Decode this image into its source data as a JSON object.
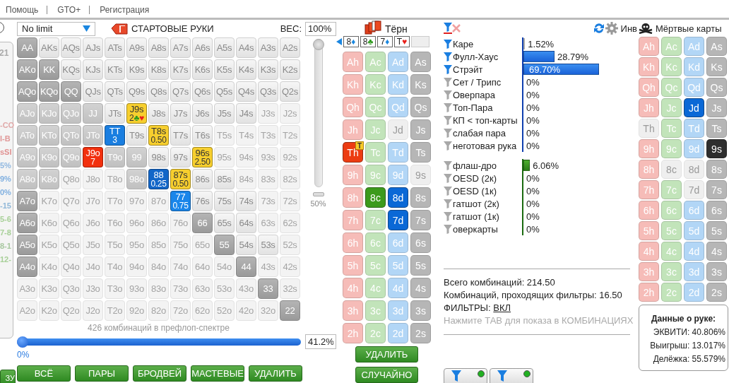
{
  "menu": [
    {
      "label": "Помощь"
    },
    {
      "label": "GTO+"
    },
    {
      "label": "Регистрация"
    }
  ],
  "side": {
    "count": "21",
    "fragments": [
      {
        "text": "-CO",
        "color": "#e0a8a8"
      },
      {
        "text": "I-B",
        "color": "#e09898"
      },
      {
        "text": "sSI",
        "color": "#e09090"
      },
      {
        "text": "5%",
        "color": "#90b8e0"
      },
      {
        "text": "9%",
        "color": "#80b0e0"
      },
      {
        "text": "0%",
        "color": "#80b0e0"
      },
      {
        "text": "-15",
        "color": "#90b8d8"
      },
      {
        "text": "5-6",
        "color": "#a8d098"
      },
      {
        "text": "7-8",
        "color": "#a8d098"
      },
      {
        "text": "8-1",
        "color": "#a8c8a0"
      },
      {
        "text": "12-",
        "color": "#a8d098"
      }
    ],
    "button": "ЗУ",
    "radio_selected": false
  },
  "range": {
    "game": "No limit",
    "title": "СТАРТОВЫЕ РУКИ",
    "weight_label": "ВЕС:",
    "weight": "100%",
    "weight_slider": {
      "level": 1,
      "mark": "50%"
    },
    "hands": [
      {
        "cells": [
          {
            "label": "AA",
            "kind": "full"
          },
          {
            "label": "AKs",
            "kind": "open"
          },
          {
            "label": "AQs",
            "kind": "open"
          },
          {
            "label": "AJs",
            "kind": "open"
          },
          {
            "label": "ATs",
            "kind": "open"
          },
          {
            "label": "A9s",
            "kind": "open"
          },
          {
            "label": "A8s",
            "kind": "open"
          },
          {
            "label": "A7s",
            "kind": "open"
          },
          {
            "label": "A6s",
            "kind": "open"
          },
          {
            "label": "A5s",
            "kind": "open"
          },
          {
            "label": "A4s",
            "kind": "open"
          },
          {
            "label": "A3s",
            "kind": "open"
          },
          {
            "label": "A2s",
            "kind": "open"
          }
        ]
      },
      {
        "cells": [
          {
            "label": "AKo",
            "kind": "full"
          },
          {
            "label": "KK",
            "kind": "full"
          },
          {
            "label": "KQs",
            "kind": "open"
          },
          {
            "label": "KJs",
            "kind": "open"
          },
          {
            "label": "KTs",
            "kind": "open"
          },
          {
            "label": "K9s",
            "kind": "open"
          },
          {
            "label": "K8s",
            "kind": "open"
          },
          {
            "label": "K7s",
            "kind": "open"
          },
          {
            "label": "K6s",
            "kind": "open"
          },
          {
            "label": "K5s",
            "kind": "open"
          },
          {
            "label": "K4s",
            "kind": "open"
          },
          {
            "label": "K3s",
            "kind": "open"
          },
          {
            "label": "K2s",
            "kind": "open"
          }
        ]
      },
      {
        "cells": [
          {
            "label": "AQo",
            "kind": "full"
          },
          {
            "label": "KQo",
            "kind": "full"
          },
          {
            "label": "QQ",
            "kind": "full"
          },
          {
            "label": "QJs",
            "kind": "open"
          },
          {
            "label": "QTs",
            "kind": "open"
          },
          {
            "label": "Q9s",
            "kind": "open"
          },
          {
            "label": "Q8s",
            "kind": "open"
          },
          {
            "label": "Q7s",
            "kind": "open"
          },
          {
            "label": "Q6s",
            "kind": "open"
          },
          {
            "label": "Q5s",
            "kind": "open"
          },
          {
            "label": "Q4s",
            "kind": "open"
          },
          {
            "label": "Q3s",
            "kind": "open"
          },
          {
            "label": "Q2s",
            "kind": "open"
          }
        ]
      },
      {
        "cells": [
          {
            "label": "AJo",
            "kind": "partial"
          },
          {
            "label": "KJo",
            "kind": "partial"
          },
          {
            "label": "QJo",
            "kind": "partial"
          },
          {
            "label": "JJ",
            "kind": "partial"
          },
          {
            "label": "JTs",
            "kind": "open"
          },
          {
            "label": "J9s",
            "kind": "marked",
            "color": "#f7cf2e",
            "note": "2",
            "suits": [
              {
                "symbol": "♣",
                "color": "#2e9a1e"
              },
              {
                "symbol": "♥",
                "color": "#e8201a"
              }
            ]
          },
          {
            "label": "J8s",
            "kind": "open"
          },
          {
            "label": "J7s",
            "kind": "open"
          },
          {
            "label": "J6s",
            "kind": "open"
          },
          {
            "label": "J5s",
            "kind": "open"
          },
          {
            "label": "J4s",
            "kind": "open"
          },
          {
            "label": "J3s",
            "kind": "faded"
          },
          {
            "label": "J2s",
            "kind": "faded"
          }
        ]
      },
      {
        "cells": [
          {
            "label": "ATo",
            "kind": "partial"
          },
          {
            "label": "KTo",
            "kind": "partial"
          },
          {
            "label": "QTo",
            "kind": "partial"
          },
          {
            "label": "JTo",
            "kind": "partial"
          },
          {
            "label": "TT",
            "kind": "marked",
            "color": "#1a7ee0",
            "note": "3"
          },
          {
            "label": "T9s",
            "kind": "open"
          },
          {
            "label": "T8s",
            "kind": "marked",
            "color": "#f7cf2e",
            "note": "0.50"
          },
          {
            "label": "T7s",
            "kind": "open"
          },
          {
            "label": "T6s",
            "kind": "open"
          },
          {
            "label": "T5s",
            "kind": "faded"
          },
          {
            "label": "T4s",
            "kind": "faded"
          },
          {
            "label": "T3s",
            "kind": "faded"
          },
          {
            "label": "T2s",
            "kind": "faded"
          }
        ]
      },
      {
        "cells": [
          {
            "label": "A9o",
            "kind": "partial"
          },
          {
            "label": "K9o",
            "kind": "partial"
          },
          {
            "label": "Q9o",
            "kind": "partial"
          },
          {
            "label": "J9o",
            "kind": "marked",
            "color": "#f2300e",
            "note": "7"
          },
          {
            "label": "T9o",
            "kind": "partial"
          },
          {
            "label": "99",
            "kind": "partial"
          },
          {
            "label": "98s",
            "kind": "open"
          },
          {
            "label": "97s",
            "kind": "open"
          },
          {
            "label": "96s",
            "kind": "marked",
            "color": "#f7cf2e",
            "note": "2.50"
          },
          {
            "label": "95s",
            "kind": "faded"
          },
          {
            "label": "94s",
            "kind": "faded"
          },
          {
            "label": "93s",
            "kind": "faded"
          },
          {
            "label": "92s",
            "kind": "faded"
          }
        ]
      },
      {
        "cells": [
          {
            "label": "A8o",
            "kind": "partial"
          },
          {
            "label": "K8o",
            "kind": "partial"
          },
          {
            "label": "Q8o",
            "kind": "faded"
          },
          {
            "label": "J8o",
            "kind": "faded"
          },
          {
            "label": "T8o",
            "kind": "faded"
          },
          {
            "label": "98o",
            "kind": "partial"
          },
          {
            "label": "88",
            "kind": "marked",
            "color": "#1266c8",
            "note": "0.25"
          },
          {
            "label": "87s",
            "kind": "marked",
            "color": "#f7cf2e",
            "note": "0.50"
          },
          {
            "label": "86s",
            "kind": "open"
          },
          {
            "label": "85s",
            "kind": "open"
          },
          {
            "label": "84s",
            "kind": "faded"
          },
          {
            "label": "83s",
            "kind": "faded"
          },
          {
            "label": "82s",
            "kind": "faded"
          }
        ]
      },
      {
        "cells": [
          {
            "label": "A7o",
            "kind": "full"
          },
          {
            "label": "K7o",
            "kind": "faded"
          },
          {
            "label": "Q7o",
            "kind": "faded"
          },
          {
            "label": "J7o",
            "kind": "faded"
          },
          {
            "label": "T7o",
            "kind": "faded"
          },
          {
            "label": "97o",
            "kind": "faded"
          },
          {
            "label": "87o",
            "kind": "faded"
          },
          {
            "label": "77",
            "kind": "marked",
            "color": "#1a86ea",
            "note": "0.75"
          },
          {
            "label": "76s",
            "kind": "open"
          },
          {
            "label": "75s",
            "kind": "open"
          },
          {
            "label": "74s",
            "kind": "open"
          },
          {
            "label": "73s",
            "kind": "faded"
          },
          {
            "label": "72s",
            "kind": "faded"
          }
        ]
      },
      {
        "cells": [
          {
            "label": "A6o",
            "kind": "full"
          },
          {
            "label": "K6o",
            "kind": "faded"
          },
          {
            "label": "Q6o",
            "kind": "faded"
          },
          {
            "label": "J6o",
            "kind": "faded"
          },
          {
            "label": "T6o",
            "kind": "faded"
          },
          {
            "label": "96o",
            "kind": "faded"
          },
          {
            "label": "86o",
            "kind": "faded"
          },
          {
            "label": "76o",
            "kind": "faded"
          },
          {
            "label": "66",
            "kind": "full"
          },
          {
            "label": "65s",
            "kind": "open"
          },
          {
            "label": "64s",
            "kind": "open"
          },
          {
            "label": "63s",
            "kind": "faded"
          },
          {
            "label": "62s",
            "kind": "faded"
          }
        ]
      },
      {
        "cells": [
          {
            "label": "A5o",
            "kind": "full"
          },
          {
            "label": "K5o",
            "kind": "faded"
          },
          {
            "label": "Q5o",
            "kind": "faded"
          },
          {
            "label": "J5o",
            "kind": "faded"
          },
          {
            "label": "T5o",
            "kind": "faded"
          },
          {
            "label": "95o",
            "kind": "faded"
          },
          {
            "label": "85o",
            "kind": "faded"
          },
          {
            "label": "75o",
            "kind": "faded"
          },
          {
            "label": "65o",
            "kind": "faded"
          },
          {
            "label": "55",
            "kind": "full"
          },
          {
            "label": "54s",
            "kind": "open"
          },
          {
            "label": "53s",
            "kind": "open"
          },
          {
            "label": "52s",
            "kind": "faded"
          }
        ]
      },
      {
        "cells": [
          {
            "label": "A4o",
            "kind": "full"
          },
          {
            "label": "K4o",
            "kind": "faded"
          },
          {
            "label": "Q4o",
            "kind": "faded"
          },
          {
            "label": "J4o",
            "kind": "faded"
          },
          {
            "label": "T4o",
            "kind": "faded"
          },
          {
            "label": "94o",
            "kind": "faded"
          },
          {
            "label": "84o",
            "kind": "faded"
          },
          {
            "label": "74o",
            "kind": "faded"
          },
          {
            "label": "64o",
            "kind": "faded"
          },
          {
            "label": "54o",
            "kind": "faded"
          },
          {
            "label": "44",
            "kind": "full"
          },
          {
            "label": "43s",
            "kind": "faded"
          },
          {
            "label": "42s",
            "kind": "faded"
          }
        ]
      },
      {
        "cells": [
          {
            "label": "A3o",
            "kind": "faded"
          },
          {
            "label": "K3o",
            "kind": "faded"
          },
          {
            "label": "Q3o",
            "kind": "faded"
          },
          {
            "label": "J3o",
            "kind": "faded"
          },
          {
            "label": "T3o",
            "kind": "faded"
          },
          {
            "label": "93o",
            "kind": "faded"
          },
          {
            "label": "83o",
            "kind": "faded"
          },
          {
            "label": "73o",
            "kind": "faded"
          },
          {
            "label": "63o",
            "kind": "faded"
          },
          {
            "label": "53o",
            "kind": "faded"
          },
          {
            "label": "43o",
            "kind": "faded"
          },
          {
            "label": "33",
            "kind": "full"
          },
          {
            "label": "32s",
            "kind": "faded"
          }
        ]
      },
      {
        "cells": [
          {
            "label": "A2o",
            "kind": "faded"
          },
          {
            "label": "K2o",
            "kind": "faded"
          },
          {
            "label": "Q2o",
            "kind": "faded"
          },
          {
            "label": "J2o",
            "kind": "faded"
          },
          {
            "label": "T2o",
            "kind": "faded"
          },
          {
            "label": "92o",
            "kind": "faded"
          },
          {
            "label": "82o",
            "kind": "faded"
          },
          {
            "label": "72o",
            "kind": "faded"
          },
          {
            "label": "62o",
            "kind": "faded"
          },
          {
            "label": "52o",
            "kind": "faded"
          },
          {
            "label": "42o",
            "kind": "faded"
          },
          {
            "label": "32o",
            "kind": "faded"
          },
          {
            "label": "22",
            "kind": "full"
          }
        ]
      }
    ],
    "caption": "426 комбинаций в префлоп-спектре",
    "range_slider": {
      "level": 0,
      "reading": "0%"
    },
    "percent": "41.2%",
    "buttons": [
      "ВСЁ",
      "ПАРЫ",
      "БРОДВЕЙ",
      "МАСТЕВЫЕ",
      "УДАЛИТЬ"
    ]
  },
  "board": {
    "street": "Тёрн",
    "slots": [
      {
        "kind": "card",
        "rank": "8",
        "suit": "♦",
        "color": "#1a88e0"
      },
      {
        "kind": "card",
        "rank": "8",
        "suit": "♣",
        "color": "#2e9a1e"
      },
      {
        "kind": "card",
        "rank": "7",
        "suit": "♦",
        "color": "#1a88e0"
      },
      {
        "kind": "card",
        "rank": "T",
        "suit": "♥",
        "color": "#e8201a"
      },
      {
        "kind": "empty"
      }
    ],
    "columns": [
      {
        "kind": "hearts",
        "cards": [
          {
            "label": "Ah",
            "selected": false,
            "disabled": false
          },
          {
            "label": "Kh",
            "selected": false,
            "disabled": false
          },
          {
            "label": "Qh",
            "selected": false,
            "disabled": false
          },
          {
            "label": "Jh",
            "selected": false,
            "disabled": false
          },
          {
            "label": "Th",
            "selected": true,
            "disabled": false,
            "badge": "T"
          },
          {
            "label": "9h",
            "selected": false,
            "disabled": false
          },
          {
            "label": "8h",
            "selected": false,
            "disabled": false
          },
          {
            "label": "7h",
            "selected": false,
            "disabled": false
          },
          {
            "label": "6h",
            "selected": false,
            "disabled": false
          },
          {
            "label": "5h",
            "selected": false,
            "disabled": false
          },
          {
            "label": "4h",
            "selected": false,
            "disabled": false
          },
          {
            "label": "3h",
            "selected": false,
            "disabled": false
          },
          {
            "label": "2h",
            "selected": false,
            "disabled": false
          }
        ]
      },
      {
        "kind": "clubs",
        "cards": [
          {
            "label": "Ac",
            "selected": false,
            "disabled": false
          },
          {
            "label": "Kc",
            "selected": false,
            "disabled": false
          },
          {
            "label": "Qc",
            "selected": false,
            "disabled": false
          },
          {
            "label": "Jc",
            "selected": false,
            "disabled": false
          },
          {
            "label": "Tc",
            "selected": false,
            "disabled": false
          },
          {
            "label": "9c",
            "selected": false,
            "disabled": false
          },
          {
            "label": "8c",
            "selected": true,
            "disabled": false
          },
          {
            "label": "7c",
            "selected": false,
            "disabled": false
          },
          {
            "label": "6c",
            "selected": false,
            "disabled": false
          },
          {
            "label": "5c",
            "selected": false,
            "disabled": false
          },
          {
            "label": "4c",
            "selected": false,
            "disabled": false
          },
          {
            "label": "3c",
            "selected": false,
            "disabled": false
          },
          {
            "label": "2c",
            "selected": false,
            "disabled": false
          }
        ]
      },
      {
        "kind": "diamonds",
        "cards": [
          {
            "label": "Ad",
            "selected": false,
            "disabled": false
          },
          {
            "label": "Kd",
            "selected": false,
            "disabled": false
          },
          {
            "label": "Qd",
            "selected": false,
            "disabled": false
          },
          {
            "label": "Jd",
            "selected": false,
            "disabled": true
          },
          {
            "label": "Td",
            "selected": false,
            "disabled": false
          },
          {
            "label": "9d",
            "selected": false,
            "disabled": false
          },
          {
            "label": "8d",
            "selected": true,
            "disabled": false
          },
          {
            "label": "7d",
            "selected": true,
            "disabled": false
          },
          {
            "label": "6d",
            "selected": false,
            "disabled": false
          },
          {
            "label": "5d",
            "selected": false,
            "disabled": false
          },
          {
            "label": "4d",
            "selected": false,
            "disabled": false
          },
          {
            "label": "3d",
            "selected": false,
            "disabled": false
          },
          {
            "label": "2d",
            "selected": false,
            "disabled": false
          }
        ]
      },
      {
        "kind": "spades",
        "cards": [
          {
            "label": "As",
            "selected": false,
            "disabled": false
          },
          {
            "label": "Ks",
            "selected": false,
            "disabled": false
          },
          {
            "label": "Qs",
            "selected": false,
            "disabled": false
          },
          {
            "label": "Js",
            "selected": false,
            "disabled": false
          },
          {
            "label": "Ts",
            "selected": false,
            "disabled": false
          },
          {
            "label": "9s",
            "selected": false,
            "disabled": true
          },
          {
            "label": "8s",
            "selected": false,
            "disabled": false
          },
          {
            "label": "7s",
            "selected": false,
            "disabled": false
          },
          {
            "label": "6s",
            "selected": false,
            "disabled": false
          },
          {
            "label": "5s",
            "selected": false,
            "disabled": false
          },
          {
            "label": "4s",
            "selected": false,
            "disabled": false
          },
          {
            "label": "3s",
            "selected": false,
            "disabled": false
          },
          {
            "label": "2s",
            "selected": false,
            "disabled": false
          }
        ]
      }
    ],
    "buttons": [
      "УДАЛИТЬ",
      "СЛУЧАЙНО"
    ]
  },
  "stats": {
    "invert_label": "Инв",
    "made": [
      {
        "label": "Каре",
        "value": "1.52%",
        "level": 0.0152,
        "active": true
      },
      {
        "label": "Фулл-Хаус",
        "value": "28.79%",
        "level": 0.2879,
        "active": true
      },
      {
        "label": "Стрэйт",
        "value": "69.70%",
        "level": 0.697,
        "active": true
      },
      {
        "label": "Сет / Трипс",
        "value": "0%",
        "active": false
      },
      {
        "label": "Оверпара",
        "value": "0%",
        "active": false
      },
      {
        "label": "Топ-Пара",
        "value": "0%",
        "active": false
      },
      {
        "label": "КП < топ-карты",
        "value": "0%",
        "active": false
      },
      {
        "label": "слабая пара",
        "value": "0%",
        "active": false
      },
      {
        "label": "неготовая рука",
        "value": "0%",
        "active": false
      }
    ],
    "draws": [
      {
        "label": "флаш-дро",
        "value": "6.06%",
        "level": 0.0606,
        "active": false
      },
      {
        "label": "OESD (2к)",
        "value": "0%",
        "active": false
      },
      {
        "label": "OESD (1к)",
        "value": "0%",
        "active": false
      },
      {
        "label": "гатшот (2к)",
        "value": "0%",
        "active": false
      },
      {
        "label": "гатшот (1к)",
        "value": "0%",
        "active": false
      },
      {
        "label": "оверкарты",
        "value": "0%",
        "active": false
      }
    ],
    "totals": [
      "Всего комбинаций: 214.50",
      "Комбинаций, проходящих фильтры: 16.50"
    ],
    "filters_label": "ФИЛЬТРЫ:",
    "filters_state": "ВКЛ",
    "hint": "Нажмите ТАВ для показа в КОМБИНАЦИЯХ",
    "filter_chips": [
      {
        "on": true
      },
      {
        "on": true
      }
    ]
  },
  "dead": {
    "title": "Мёртвые карты",
    "columns": [
      {
        "kind": "hearts",
        "cards": [
          {
            "label": "Ah",
            "selected": false,
            "disabled": false
          },
          {
            "label": "Kh",
            "selected": false,
            "disabled": false
          },
          {
            "label": "Qh",
            "selected": false,
            "disabled": false
          },
          {
            "label": "Jh",
            "selected": false,
            "disabled": false
          },
          {
            "label": "Th",
            "selected": false,
            "disabled": true
          },
          {
            "label": "9h",
            "selected": false,
            "disabled": false
          },
          {
            "label": "8h",
            "selected": false,
            "disabled": false
          },
          {
            "label": "7h",
            "selected": false,
            "disabled": false
          },
          {
            "label": "6h",
            "selected": false,
            "disabled": false
          },
          {
            "label": "5h",
            "selected": false,
            "disabled": false
          },
          {
            "label": "4h",
            "selected": false,
            "disabled": false
          },
          {
            "label": "3h",
            "selected": false,
            "disabled": false
          },
          {
            "label": "2h",
            "selected": false,
            "disabled": false
          }
        ]
      },
      {
        "kind": "clubs",
        "cards": [
          {
            "label": "Ac",
            "selected": false,
            "disabled": false
          },
          {
            "label": "Kc",
            "selected": false,
            "disabled": false
          },
          {
            "label": "Qc",
            "selected": false,
            "disabled": false
          },
          {
            "label": "Jc",
            "selected": false,
            "disabled": false
          },
          {
            "label": "Tc",
            "selected": false,
            "disabled": false
          },
          {
            "label": "9c",
            "selected": false,
            "disabled": false
          },
          {
            "label": "8c",
            "selected": false,
            "disabled": true
          },
          {
            "label": "7c",
            "selected": false,
            "disabled": false
          },
          {
            "label": "6c",
            "selected": false,
            "disabled": false
          },
          {
            "label": "5c",
            "selected": false,
            "disabled": false
          },
          {
            "label": "4c",
            "selected": false,
            "disabled": false
          },
          {
            "label": "3c",
            "selected": false,
            "disabled": false
          },
          {
            "label": "2c",
            "selected": false,
            "disabled": false
          }
        ]
      },
      {
        "kind": "diamonds",
        "cards": [
          {
            "label": "Ad",
            "selected": false,
            "disabled": false
          },
          {
            "label": "Kd",
            "selected": false,
            "disabled": false
          },
          {
            "label": "Qd",
            "selected": false,
            "disabled": false
          },
          {
            "label": "Jd",
            "selected": true,
            "disabled": false
          },
          {
            "label": "Td",
            "selected": false,
            "disabled": false
          },
          {
            "label": "9d",
            "selected": false,
            "disabled": false
          },
          {
            "label": "8d",
            "selected": false,
            "disabled": true
          },
          {
            "label": "7d",
            "selected": false,
            "disabled": true
          },
          {
            "label": "6d",
            "selected": false,
            "disabled": false
          },
          {
            "label": "5d",
            "selected": false,
            "disabled": false
          },
          {
            "label": "4d",
            "selected": false,
            "disabled": false
          },
          {
            "label": "3d",
            "selected": false,
            "disabled": false
          },
          {
            "label": "2d",
            "selected": false,
            "disabled": false
          }
        ]
      },
      {
        "kind": "spades",
        "cards": [
          {
            "label": "As",
            "selected": false,
            "disabled": false
          },
          {
            "label": "Ks",
            "selected": false,
            "disabled": false
          },
          {
            "label": "Qs",
            "selected": false,
            "disabled": false
          },
          {
            "label": "Js",
            "selected": false,
            "disabled": false
          },
          {
            "label": "Ts",
            "selected": false,
            "disabled": false
          },
          {
            "label": "9s",
            "selected": true,
            "disabled": false
          },
          {
            "label": "8s",
            "selected": false,
            "disabled": false
          },
          {
            "label": "7s",
            "selected": false,
            "disabled": false
          },
          {
            "label": "6s",
            "selected": false,
            "disabled": false
          },
          {
            "label": "5s",
            "selected": false,
            "disabled": false
          },
          {
            "label": "4s",
            "selected": false,
            "disabled": false
          },
          {
            "label": "3s",
            "selected": false,
            "disabled": false
          },
          {
            "label": "2s",
            "selected": false,
            "disabled": false
          }
        ]
      }
    ],
    "hand_info": {
      "title": "Данные о руке:",
      "lines": [
        "ЭКВИТИ: 40.806%",
        "Выигрыш: 13.017%",
        "Делёжка: 55.579%"
      ]
    }
  }
}
